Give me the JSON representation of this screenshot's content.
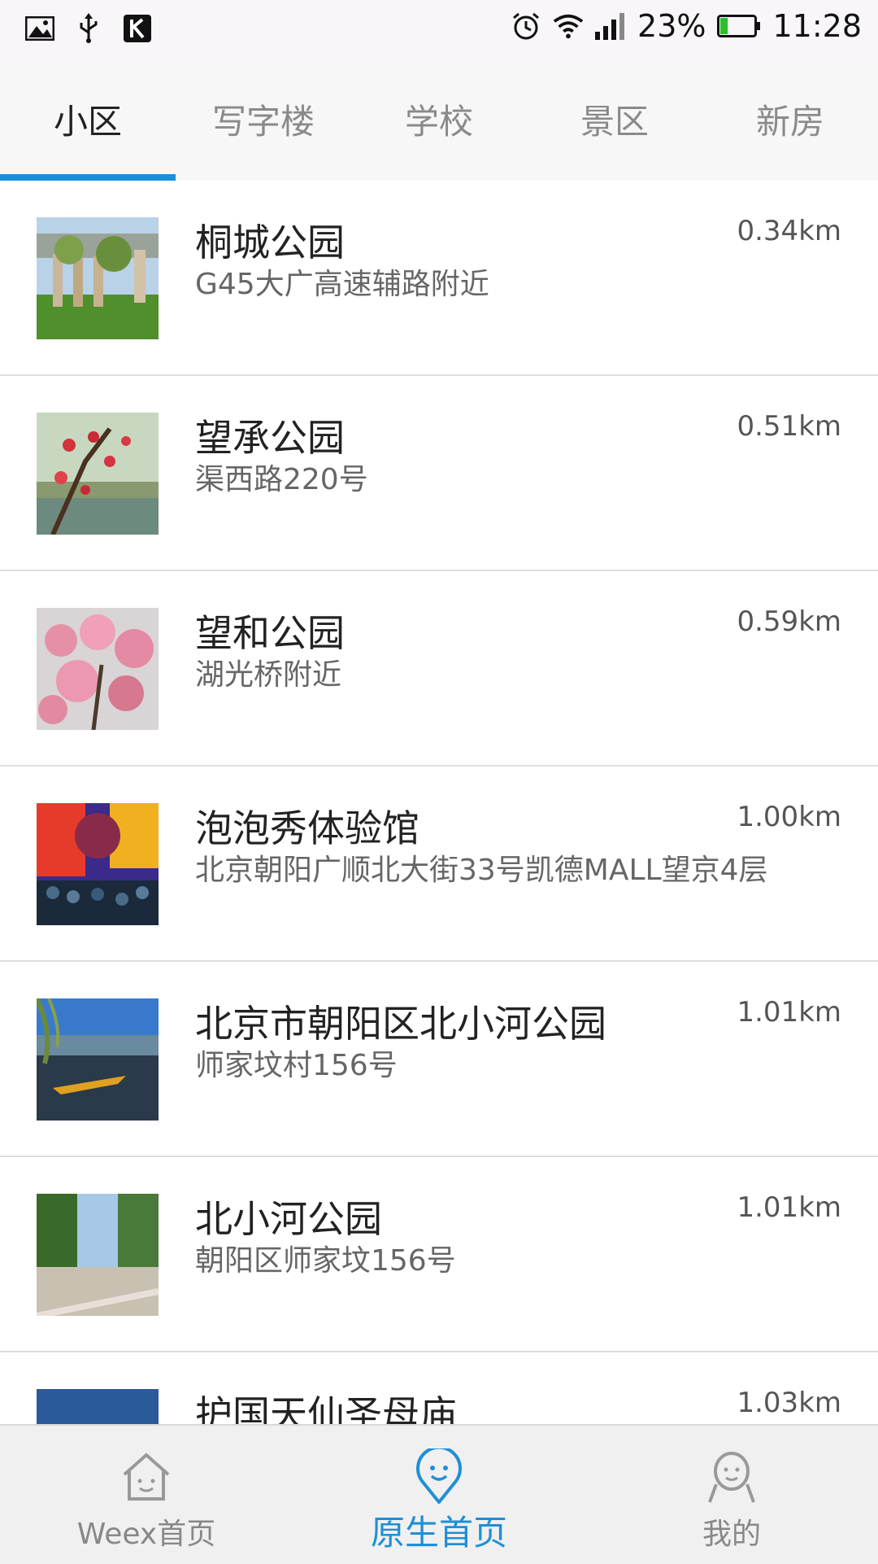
{
  "status_bar": {
    "battery_percent": "23%",
    "time": "11:28",
    "battery_level": 0.23,
    "icons_left": [
      "image-icon",
      "usb-icon",
      "k-app-icon"
    ],
    "icons_right": [
      "alarm-icon",
      "wifi-icon",
      "signal-icon",
      "battery-icon"
    ]
  },
  "tabs": [
    {
      "label": "小区",
      "active": true
    },
    {
      "label": "写字楼",
      "active": false
    },
    {
      "label": "学校",
      "active": false
    },
    {
      "label": "景区",
      "active": false
    },
    {
      "label": "新房",
      "active": false
    }
  ],
  "list": [
    {
      "title": "桐城公园",
      "address": "G45大广高速辅路附近",
      "distance": "0.34km"
    },
    {
      "title": "望承公园",
      "address": "渠西路220号",
      "distance": "0.51km"
    },
    {
      "title": "望和公园",
      "address": "湖光桥附近",
      "distance": "0.59km"
    },
    {
      "title": "泡泡秀体验馆",
      "address": "北京朝阳广顺北大街33号凯德MALL望京4层",
      "distance": "1.00km"
    },
    {
      "title": "北京市朝阳区北小河公园",
      "address": "师家坟村156号",
      "distance": "1.01km"
    },
    {
      "title": "北小河公园",
      "address": "朝阳区师家坟156号",
      "distance": "1.01km"
    },
    {
      "title": "护国天仙圣母庙",
      "address": "",
      "distance": "1.03km"
    }
  ],
  "bottom_nav": [
    {
      "label": "Weex首页",
      "icon": "home-icon",
      "active": false
    },
    {
      "label": "原生首页",
      "icon": "location-pin-icon",
      "active": true
    },
    {
      "label": "我的",
      "icon": "person-icon",
      "active": false
    }
  ],
  "colors": {
    "accent": "#1e8fd6",
    "battery_fill": "#2bc02b"
  }
}
